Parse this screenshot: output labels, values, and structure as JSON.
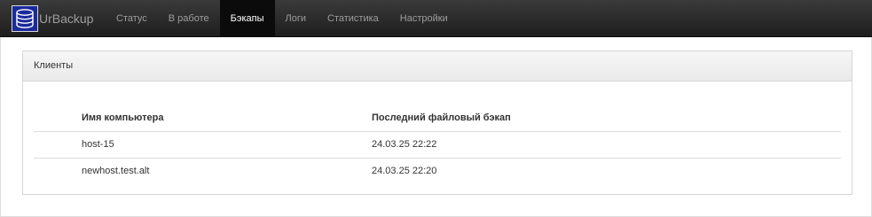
{
  "brand": {
    "name": "UrBackup",
    "logo_icon": "database-icon",
    "logo_color": "#1a2a9a"
  },
  "nav": {
    "items": [
      {
        "label": "Статус"
      },
      {
        "label": "В работе"
      },
      {
        "label": "Бэкапы",
        "active": true
      },
      {
        "label": "Логи"
      },
      {
        "label": "Статистика"
      },
      {
        "label": "Настройки"
      }
    ]
  },
  "panel": {
    "title": "Клиенты",
    "columns": [
      "Имя компьютера",
      "Последний файловый бэкап"
    ],
    "rows": [
      {
        "name": "host-15",
        "last_backup": "24.03.25 22:22"
      },
      {
        "name": "newhost.test.alt",
        "last_backup": "24.03.25 22:20"
      }
    ]
  },
  "colors": {
    "navbar_bg": "#222222",
    "active_tab_bg": "#0b0b0b",
    "nav_text": "#9d9d9d"
  }
}
